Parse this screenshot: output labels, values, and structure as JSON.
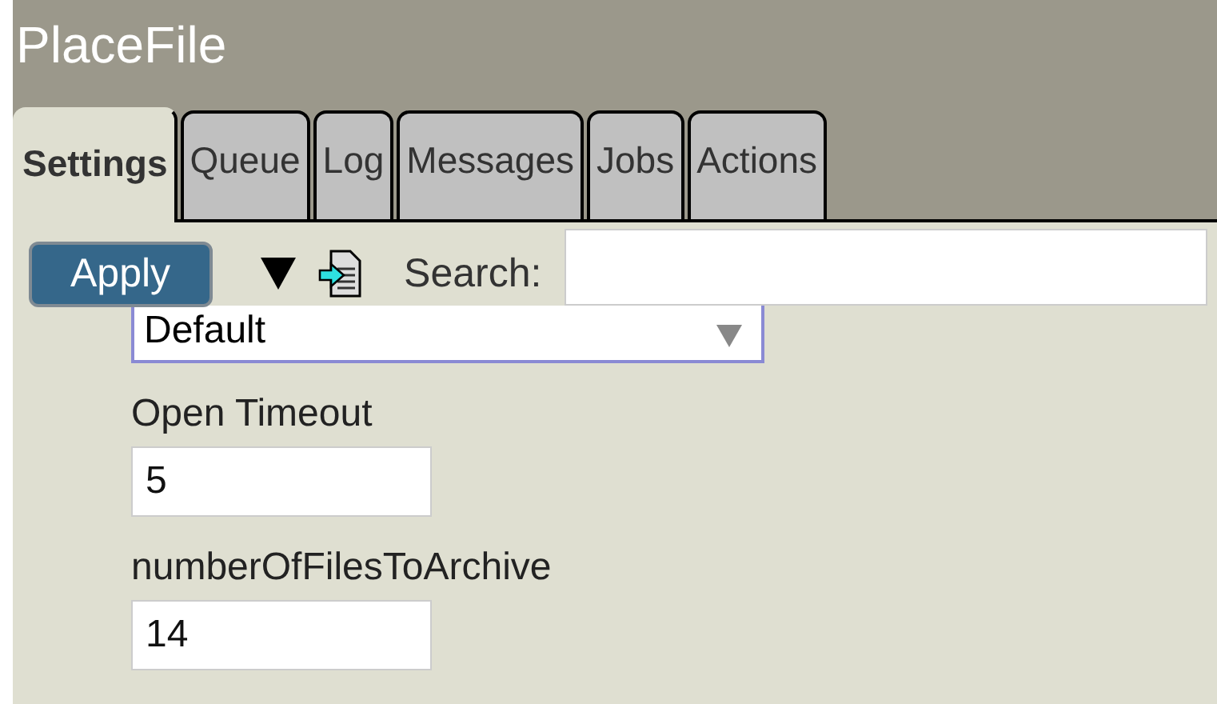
{
  "window": {
    "title": "PlaceFile"
  },
  "tabs": [
    {
      "label": "Settings",
      "selected": true
    },
    {
      "label": "Queue",
      "selected": false
    },
    {
      "label": "Log",
      "selected": false
    },
    {
      "label": "Messages",
      "selected": false
    },
    {
      "label": "Jobs",
      "selected": false
    },
    {
      "label": "Actions",
      "selected": false
    }
  ],
  "toolbar": {
    "apply": "Apply",
    "search_label": "Search:"
  },
  "fields": [
    {
      "kind": "select",
      "value": "Default"
    },
    {
      "kind": "text",
      "label": "Open Timeout",
      "value": "5"
    },
    {
      "kind": "text",
      "label": "numberOfFilesToArchive",
      "value": "14"
    }
  ]
}
